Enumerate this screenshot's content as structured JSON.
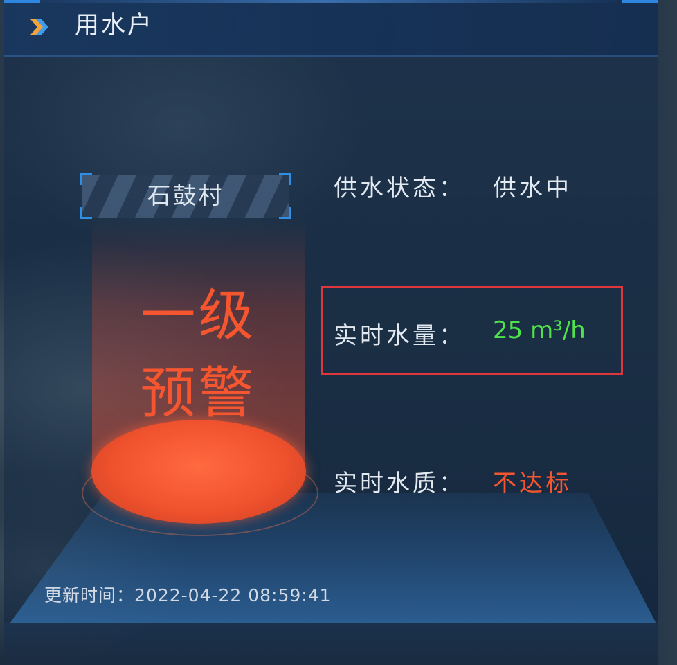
{
  "header": {
    "title": "用水户",
    "icon": "chevron-right-icon"
  },
  "village": {
    "name": "石鼓村"
  },
  "warning": {
    "line1": "一级",
    "line2": "预警",
    "color": "#f5562f"
  },
  "supply_status": {
    "label": "供水状态：",
    "value": "供水中"
  },
  "realtime_flow": {
    "label": "实时水量：",
    "value": "25 m³/h",
    "value_color": "#4ee34a"
  },
  "water_quality": {
    "label": "实时水质：",
    "value": "不达标",
    "value_color": "#f5562f"
  },
  "update": {
    "label": "更新时间：",
    "time": "2022-04-22 08:59:41"
  },
  "colors": {
    "accent": "#2e8fe6",
    "highlight_border": "#e0373f"
  }
}
